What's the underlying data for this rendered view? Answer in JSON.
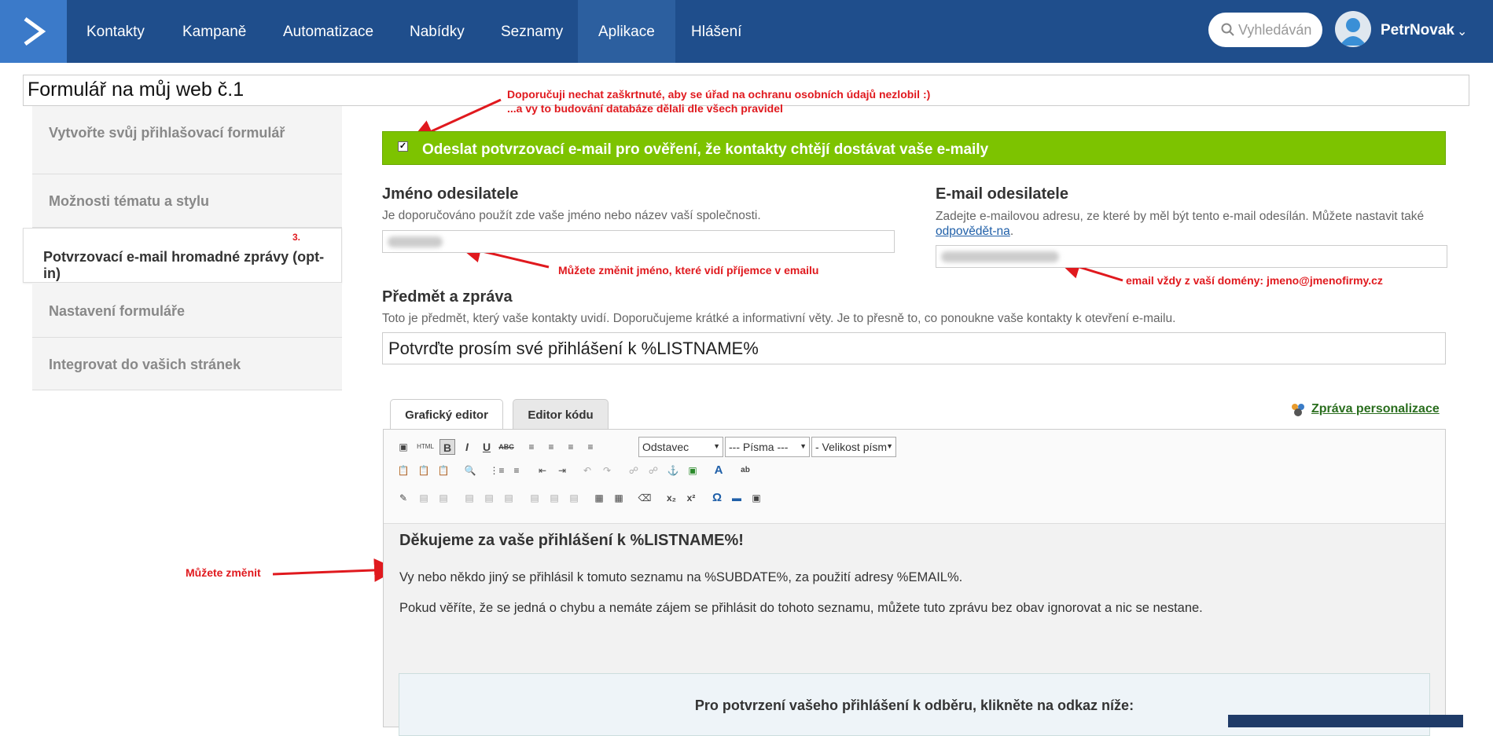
{
  "nav": {
    "items": [
      "Kontakty",
      "Kampaně",
      "Automatizace",
      "Nabídky",
      "Seznamy",
      "Aplikace",
      "Hlášení"
    ],
    "active": "Aplikace",
    "search_placeholder": "Vyhledáván",
    "user": "PetrNovak"
  },
  "form_title": "Formulář na můj web č.1",
  "sidebar": {
    "items": [
      "Vytvořte svůj přihlašovací formulář",
      "Možnosti tématu a stylu",
      "Potvrzovací e-mail hromadné zprávy (opt-in)",
      "Nastavení formuláře",
      "Integrovat do vašich stránek"
    ],
    "step_number": "3."
  },
  "annotations": {
    "checkbox_note_1": "Doporučuji nechat zaškrtnuté, aby se úřad na ochranu osobních údajů nezlobil :)",
    "checkbox_note_2": "...a vy to budování databáze dělali dle všech pravidel",
    "sender_name_note": "Můžete změnit jméno, které vidí příjemce v emailu",
    "sender_email_note": "email vždy z vaší domény: jmeno@jmenofirmy.cz",
    "message_note": "Můžete změnit"
  },
  "optin_label": "Odeslat potvrzovací e-mail pro ověření, že kontakty chtějí dostávat vaše e-maily",
  "sender_name": {
    "label": "Jméno odesilatele",
    "desc": "Je doporučováno použít zde vaše jméno nebo název vaší společnosti."
  },
  "sender_email": {
    "label": "E-mail odesilatele",
    "desc": "Zadejte e-mailovou adresu, ze které by měl být tento e-mail odesílán. Můžete nastavit také",
    "desc_link": "odpovědět-na",
    "desc_end": "."
  },
  "subject": {
    "label": "Předmět a zpráva",
    "desc": "Toto je předmět, který vaše kontakty uvidí. Doporučujeme krátké a informativní věty. Je to přesně to, co ponoukne vaše kontakty k otevření e-mailu.",
    "value": "Potvrďte prosím své přihlášení k %LISTNAME%"
  },
  "editor": {
    "tabs": [
      "Grafický editor",
      "Editor kódu"
    ],
    "personalize": "Zpráva personalizace",
    "format_select": "Odstavec",
    "font_select": "--- Písma ---",
    "size_select": "- Velikost písm"
  },
  "message": {
    "heading": "Děkujeme za vaše přihlášení k %LISTNAME%!",
    "p1": "Vy nebo někdo jiný se přihlásil k tomuto seznamu na %SUBDATE%, za použití adresy %EMAIL%.",
    "p2": "Pokud věříte, že se jedná o chybu a nemáte zájem se přihlásit do tohoto seznamu, můžete tuto zprávu bez obav ignorovat a nic se nestane.",
    "box_text": "Pro potvrzení vašeho přihlášení k odběru, klikněte na odkaz níže:"
  }
}
